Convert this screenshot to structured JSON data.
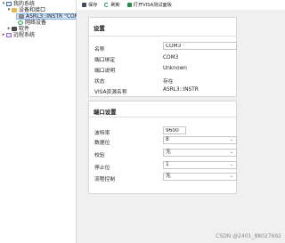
{
  "tree": {
    "root_label": "我的系统",
    "devices_label": "设备和接口",
    "port_label": "ASRL3::INSTR \"COM3\"",
    "network_label": "网络设备",
    "software_label": "软件",
    "remote_label": "远程系统"
  },
  "toolbar": {
    "save_label": "保存",
    "refresh_label": "刷新",
    "open_panel_label": "打开VISA测试面板"
  },
  "settings": {
    "title": "设置",
    "name_label": "名称",
    "name_value": "COM3",
    "port_binding_label": "端口绑定",
    "port_binding_value": "COM3",
    "port_desc_label": "端口说明",
    "port_desc_value": "Unknown",
    "status_label": "状态",
    "status_value": "存在",
    "visa_name_label": "VISA资源名称",
    "visa_name_value": "ASRL3::INSTR"
  },
  "port_settings": {
    "title": "端口设置",
    "baud_label": "波特率",
    "baud_value": "9600",
    "data_bits_label": "数据位",
    "data_bits_value": "8",
    "parity_label": "校验",
    "parity_value": "无",
    "stop_bits_label": "停止位",
    "stop_bits_value": "1",
    "flow_label": "流程控制",
    "flow_value": "无"
  },
  "watermark": "CSDN @2401_88027692"
}
